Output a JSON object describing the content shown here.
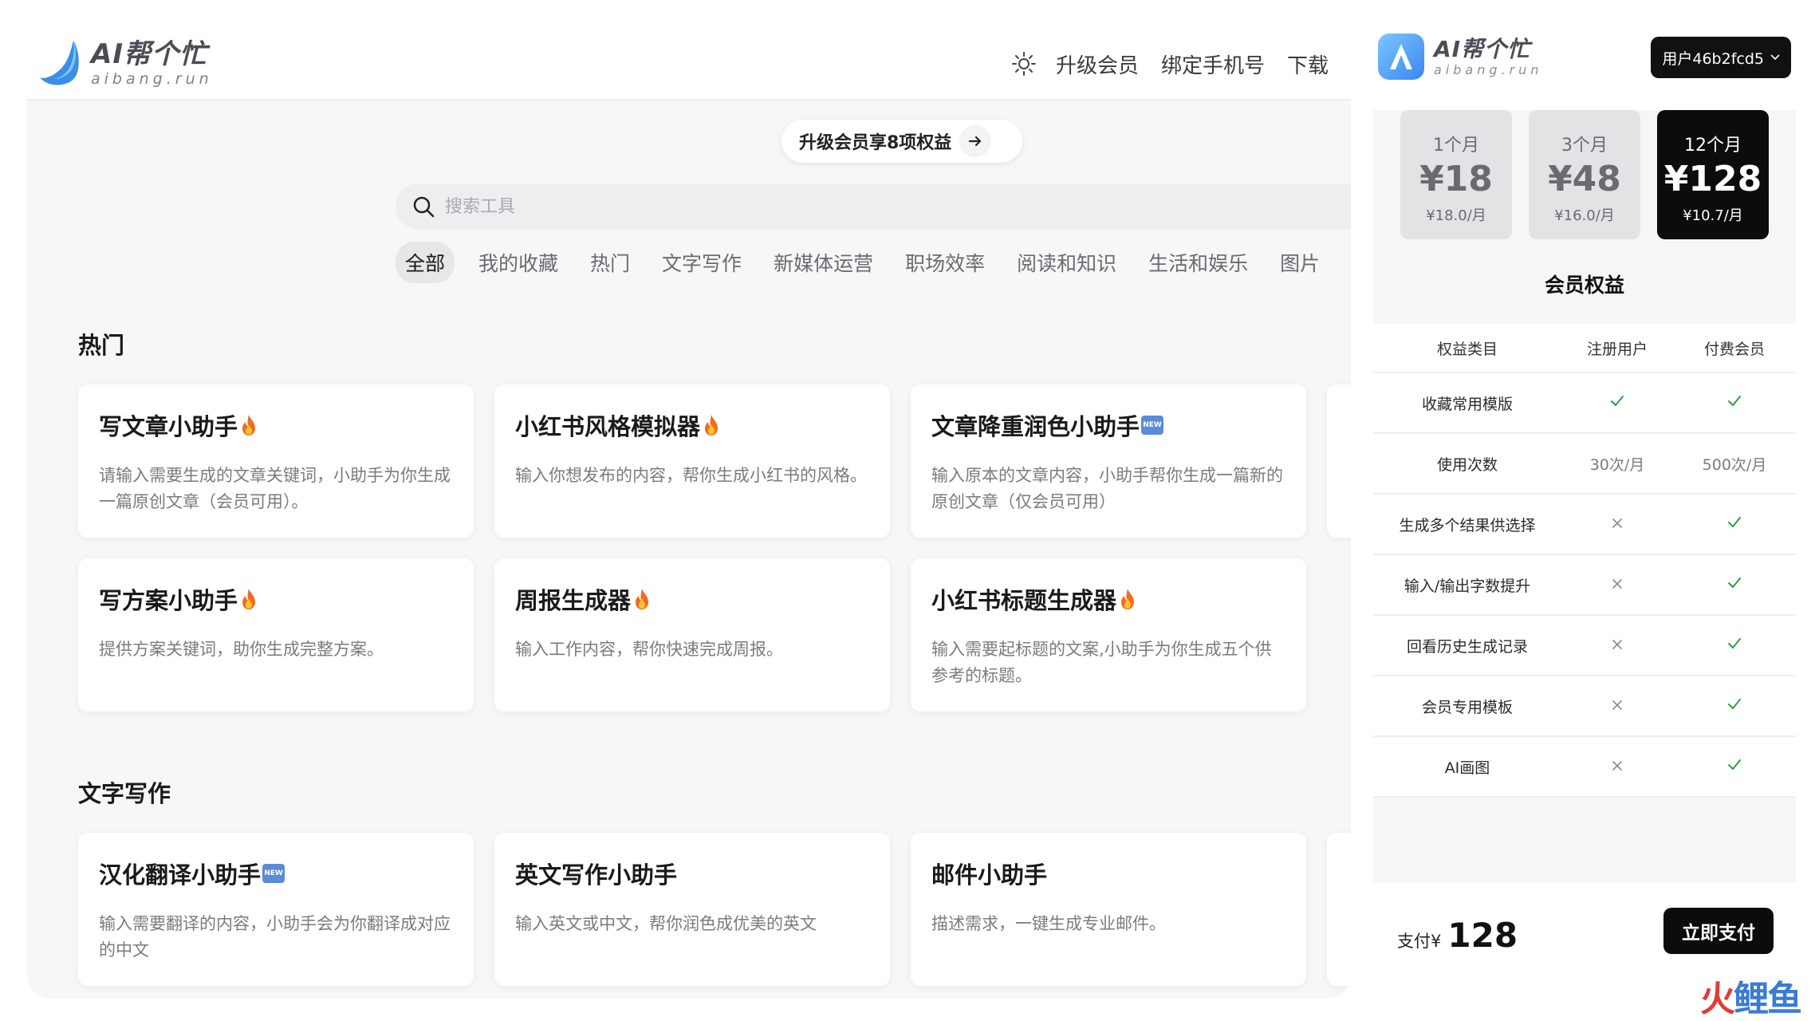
{
  "brand": {
    "name": "AI帮个忙",
    "domain": "aibang.run"
  },
  "header": {
    "nav": [
      "升级会员",
      "绑定手机号",
      "下载"
    ]
  },
  "upgrade_banner": "升级会员享8项权益",
  "search": {
    "placeholder": "搜索工具"
  },
  "categories": [
    "全部",
    "我的收藏",
    "热门",
    "文字写作",
    "新媒体运营",
    "职场效率",
    "阅读和知识",
    "生活和娱乐",
    "图片"
  ],
  "sections": [
    {
      "title": "热门",
      "cards": [
        {
          "title": "写文章小助手",
          "badge": "fire",
          "desc": "请输入需要生成的文章关键词，小助手为你生成一篇原创文章（会员可用）。"
        },
        {
          "title": "小红书风格模拟器",
          "badge": "fire",
          "desc": "输入你想发布的内容，帮你生成小红书的风格。"
        },
        {
          "title": "文章降重润色小助手",
          "badge": "new",
          "desc": "输入原本的文章内容，小助手帮你生成一篇新的原创文章（仅会员可用）"
        },
        {
          "title": "写方案小助手",
          "badge": "fire",
          "desc": "提供方案关键词，助你生成完整方案。"
        },
        {
          "title": "周报生成器",
          "badge": "fire",
          "desc": "输入工作内容，帮你快速完成周报。"
        },
        {
          "title": "小红书标题生成器",
          "badge": "fire",
          "desc": "输入需要起标题的文案,小助手为你生成五个供参考的标题。"
        }
      ]
    },
    {
      "title": "文字写作",
      "cards": [
        {
          "title": "汉化翻译小助手",
          "badge": "new",
          "desc": "输入需要翻译的内容，小助手会为你翻译成对应的中文"
        },
        {
          "title": "英文写作小助手",
          "badge": "",
          "desc": "输入英文或中文，帮你润色成优美的英文"
        },
        {
          "title": "邮件小助手",
          "badge": "",
          "desc": "描述需求，一键生成专业邮件。"
        }
      ]
    }
  ],
  "mobile": {
    "user_button": "用户46b2fcd5",
    "plans": [
      {
        "duration": "1个月",
        "price": "¥18",
        "unit_price": "¥18.0/月",
        "selected": false
      },
      {
        "duration": "3个月",
        "price": "¥48",
        "unit_price": "¥16.0/月",
        "selected": false
      },
      {
        "duration": "12个月",
        "price": "¥128",
        "unit_price": "¥10.7/月",
        "selected": true
      }
    ],
    "benefits_title": "会员权益",
    "table_headers": [
      "权益类目",
      "注册用户",
      "付费会员"
    ],
    "benefits": [
      {
        "name": "收藏常用模版",
        "free": "check",
        "paid": "check"
      },
      {
        "name": "使用次数",
        "free": "30次/月",
        "paid": "500次/月"
      },
      {
        "name": "生成多个结果供选择",
        "free": "cross",
        "paid": "check"
      },
      {
        "name": "输入/输出字数提升",
        "free": "cross",
        "paid": "check"
      },
      {
        "name": "回看历史生成记录",
        "free": "cross",
        "paid": "check"
      },
      {
        "name": "会员专用模板",
        "free": "cross",
        "paid": "check"
      },
      {
        "name": "AI画图",
        "free": "cross",
        "paid": "check"
      }
    ],
    "pay_label": "支付¥",
    "pay_amount": "128",
    "pay_button": "立即支付"
  },
  "watermark": [
    "火",
    "鲤",
    "鱼"
  ],
  "colors": {
    "check": "#2f9e44",
    "cross": "#8a8a8a",
    "selected_plan": "#0c0c0c",
    "new_badge": "#5b8bd6",
    "watermark_red": "#e33a3a"
  }
}
